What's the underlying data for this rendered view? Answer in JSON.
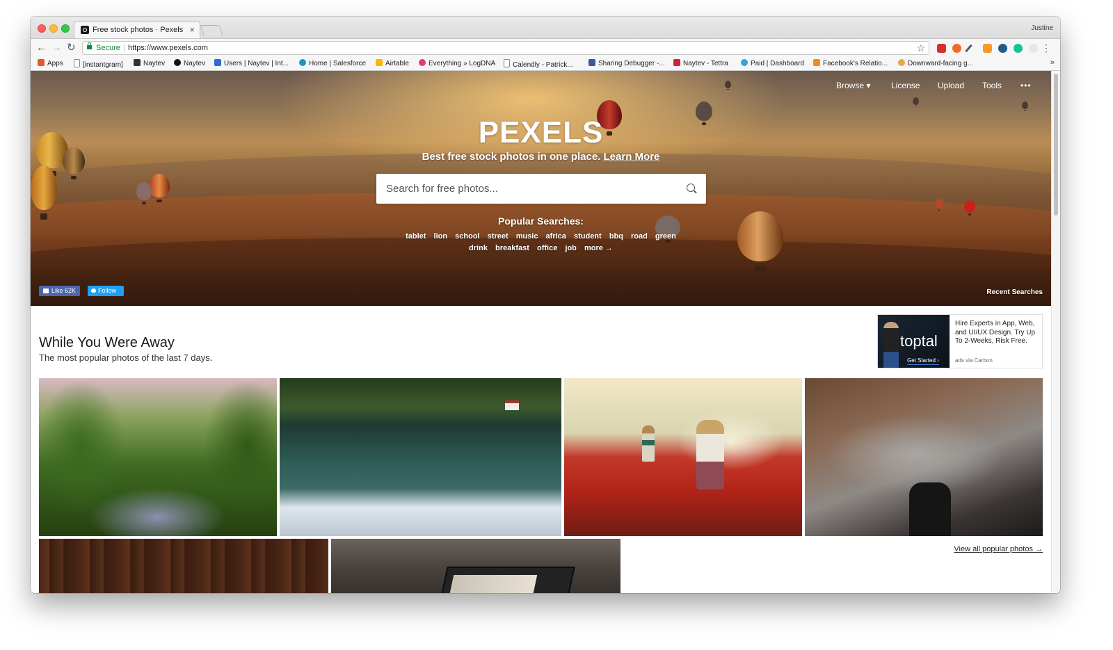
{
  "browser": {
    "tab_title": "Free stock photos · Pexels",
    "tab_close": "×",
    "profile_name": "Justine",
    "secure_label": "Secure",
    "url": "https://www.pexels.com",
    "bookmarks": [
      {
        "label": "Apps",
        "icon": "apps-grid-icon",
        "color": "#e15a2b"
      },
      {
        "label": "[instantgram]",
        "icon": "page-icon",
        "color": "#ffffff"
      },
      {
        "label": "Naytev",
        "icon": "naytev-icon",
        "color": "#333333"
      },
      {
        "label": "Naytev",
        "icon": "github-icon",
        "color": "#111111"
      },
      {
        "label": "Users | Naytev | Int...",
        "icon": "intercom-icon",
        "color": "#2f6bd4"
      },
      {
        "label": "Home | Salesforce",
        "icon": "salesforce-icon",
        "color": "#1798c1"
      },
      {
        "label": "Airtable",
        "icon": "airtable-icon",
        "color": "#fcb400"
      },
      {
        "label": "Everything » LogDNA",
        "icon": "logdna-icon",
        "color": "#e03c6e"
      },
      {
        "label": "Calendly - Patrick...",
        "icon": "page-icon",
        "color": "#ffffff"
      },
      {
        "label": "Sharing Debugger -...",
        "icon": "facebook-icon",
        "color": "#3b5998"
      },
      {
        "label": "Naytev - Tettra",
        "icon": "tettra-icon",
        "color": "#d0223f"
      },
      {
        "label": "Paid | Dashboard",
        "icon": "paid-icon",
        "color": "#3aa0d8"
      },
      {
        "label": "Facebook's Relatio...",
        "icon": "bookmark-icon",
        "color": "#f28c1c"
      },
      {
        "label": "Downward-facing g...",
        "icon": "dog-icon",
        "color": "#e8a54a"
      }
    ],
    "bookmarks_more": "»"
  },
  "nav": {
    "browse": "Browse ▾",
    "license": "License",
    "upload": "Upload",
    "tools": "Tools",
    "more": "•••"
  },
  "hero": {
    "logo": "PEXELS",
    "tagline": "Best free stock photos in one place.",
    "learn_more": "Learn More",
    "search_placeholder": "Search for free photos...",
    "popular_title": "Popular Searches:",
    "popular_row1": [
      "tablet",
      "lion",
      "school",
      "street",
      "music",
      "africa",
      "student",
      "bbq",
      "road",
      "green"
    ],
    "popular_row2": [
      "drink",
      "breakfast",
      "office",
      "job",
      "more →"
    ],
    "fb_like": "Like 62K",
    "tw_follow": "Follow",
    "recent_searches": "Recent Searches"
  },
  "section": {
    "title": "While You Were Away",
    "subtitle": "The most popular photos of the last 7 days.",
    "view_all": "View all popular photos →"
  },
  "ad": {
    "brand": "toptal",
    "cta": "Get Started ›",
    "copy": "Hire Experts in App, Web, and UI/UX Design. Try Up To 2-Weeks, Risk Free.",
    "via": "ads via Carbon"
  },
  "colors": {
    "secure_green": "#0a8a33",
    "facebook_blue": "#4a67ad",
    "twitter_blue": "#1da1f2"
  }
}
